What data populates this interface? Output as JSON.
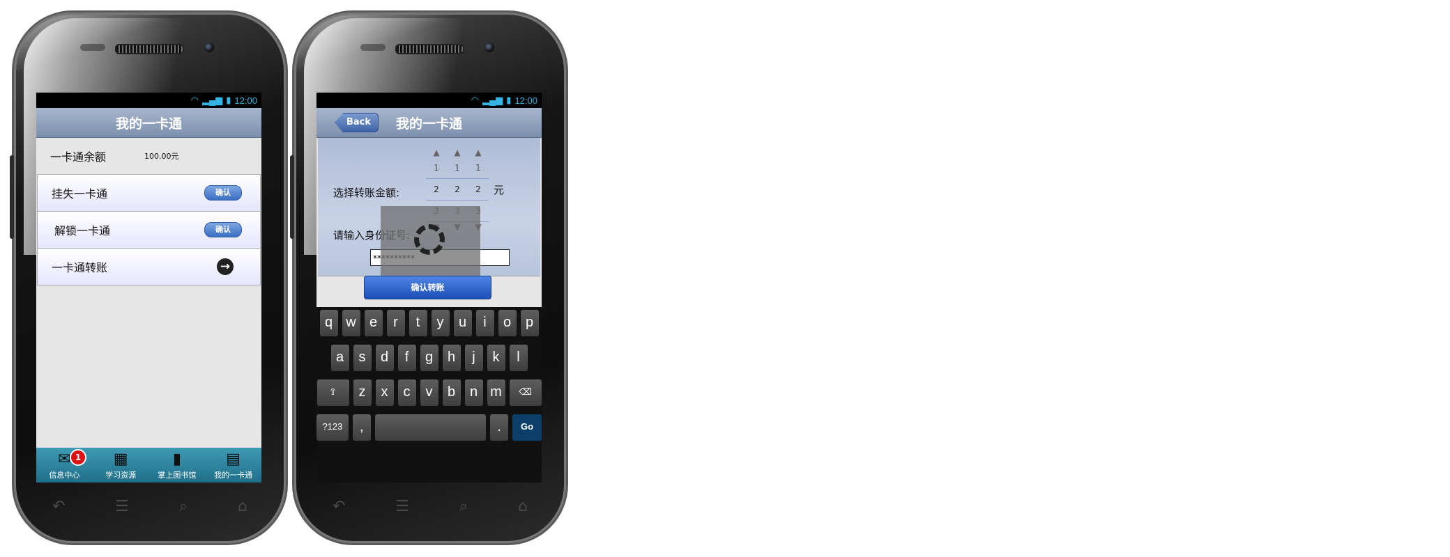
{
  "status": {
    "time": "12:00"
  },
  "screen1": {
    "title": "我的一卡通",
    "balance_label": "一卡通余额",
    "balance_value": "100.00元",
    "items": [
      {
        "label": "挂失一卡通",
        "button": "确认"
      },
      {
        "label": "解锁一卡通",
        "button": "确认"
      },
      {
        "label": "一卡通转账"
      }
    ],
    "tabs": [
      {
        "label": "信息中心",
        "icon": "mail-icon",
        "badge": "1"
      },
      {
        "label": "学习资源",
        "icon": "calendar-icon"
      },
      {
        "label": "掌上图书馆",
        "icon": "book-icon"
      },
      {
        "label": "我的一卡通",
        "icon": "card-icon"
      }
    ]
  },
  "screen2": {
    "title": "我的一卡通",
    "back_label": "Back",
    "amount_label": "选择转账金额:",
    "unit": "元",
    "picker_values": [
      "1",
      "2",
      "3"
    ],
    "id_label": "请输入身份证号:",
    "id_value": "**********",
    "confirm_label": "确认转账"
  },
  "keyboard": {
    "row1": [
      "q",
      "w",
      "e",
      "r",
      "t",
      "y",
      "u",
      "i",
      "o",
      "p"
    ],
    "row2": [
      "a",
      "s",
      "d",
      "f",
      "g",
      "h",
      "j",
      "k",
      "l"
    ],
    "row3": [
      "z",
      "x",
      "c",
      "v",
      "b",
      "n",
      "m"
    ],
    "sym_label": "?123",
    "comma": ",",
    "period": ".",
    "go_label": "Go"
  },
  "colors": {
    "status_accent": "#33b5e5",
    "tabbar": "#2a8099",
    "confirm": "#2a5cc6"
  }
}
